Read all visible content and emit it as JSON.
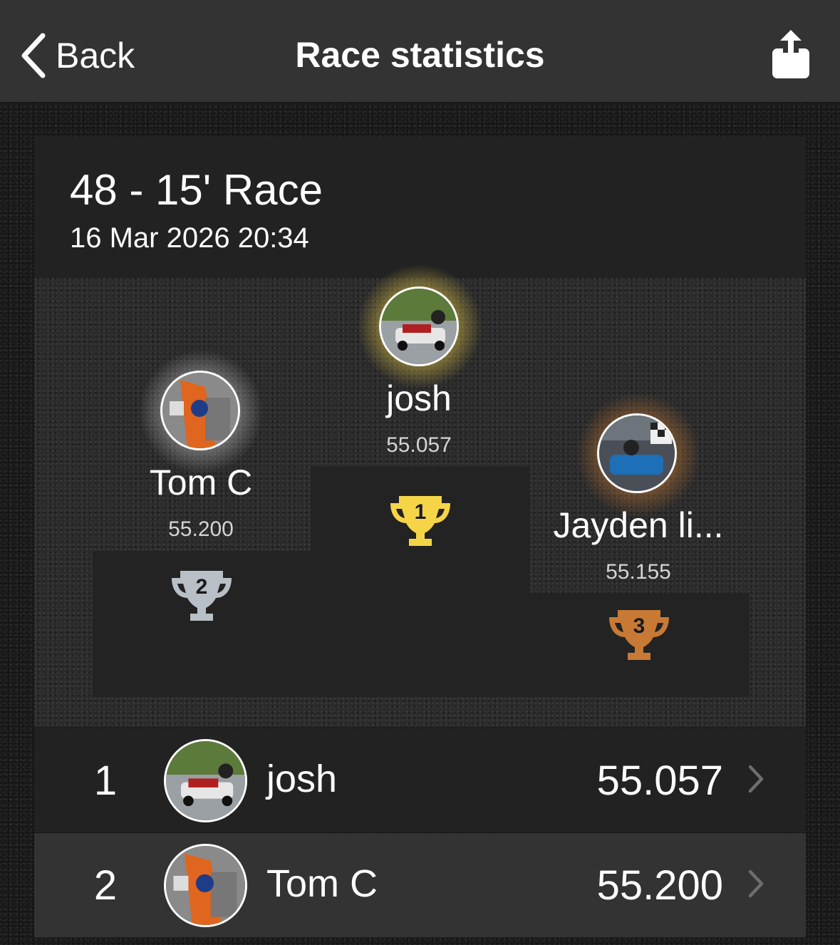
{
  "nav": {
    "back_label": "Back",
    "title": "Race statistics",
    "share_icon": "share-icon"
  },
  "race": {
    "name": "48 - 15' Race",
    "date": "16 Mar 2026 20:34"
  },
  "podium": {
    "first": {
      "name": "josh",
      "time": "55.057",
      "place": "1"
    },
    "second": {
      "name": "Tom C",
      "time": "55.200",
      "place": "2"
    },
    "third": {
      "name": "Jayden li...",
      "time": "55.155",
      "place": "3"
    }
  },
  "results": [
    {
      "position": "1",
      "name": "josh",
      "time": "55.057"
    },
    {
      "position": "2",
      "name": "Tom C",
      "time": "55.200"
    }
  ],
  "colors": {
    "gold": "#f5d547",
    "silver": "#b9bfc6",
    "bronze": "#c87a35",
    "navbar": "#333333",
    "card": "#222222"
  }
}
